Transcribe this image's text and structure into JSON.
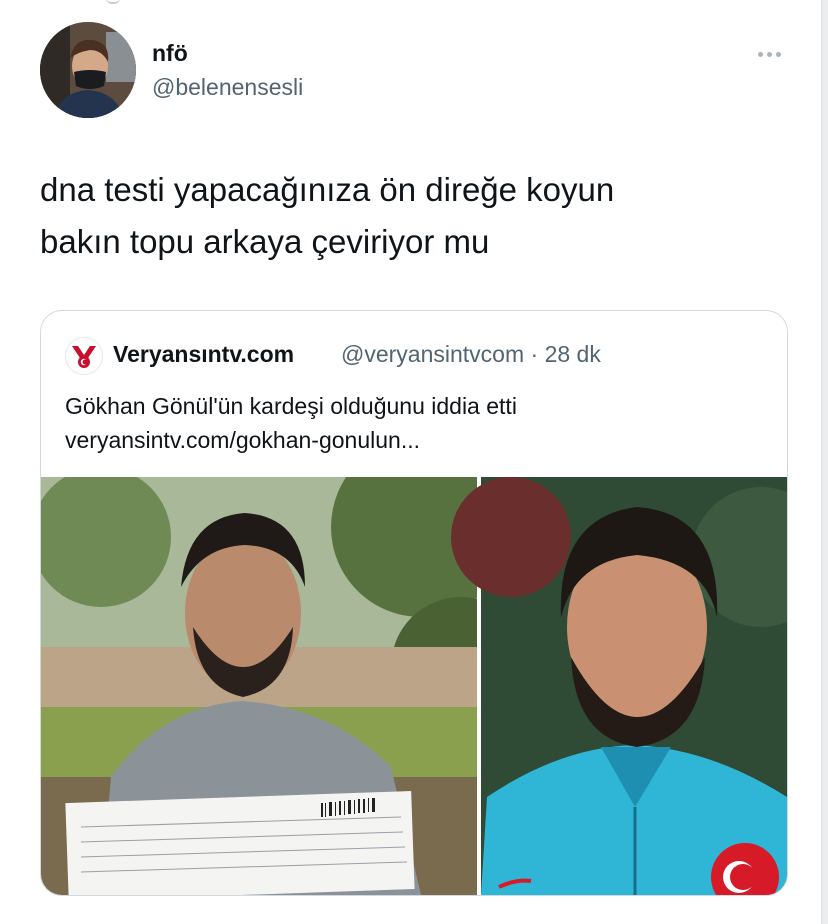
{
  "tweet": {
    "author": {
      "display_name": "nfö",
      "handle": "@belenensesli"
    },
    "text_line1": "dna testi yapacağınıza ön direğe koyun",
    "text_line2": "bakın topu arkaya çeviriyor mu",
    "more_icon": "more-horizontal-icon"
  },
  "quoted": {
    "display_name": "Veryansıntv.com",
    "handle": "@veryansintvcom",
    "separator": "·",
    "time": "28 dk",
    "text": "Gökhan Gönül'ün kardeşi olduğunu iddia etti",
    "link": "veryansintv.com/gokhan-gonulun...",
    "logo_icon": "veryansin-logo-icon",
    "accent_color": "#c8102e"
  },
  "colors": {
    "text_primary": "#0f1419",
    "text_secondary": "#536471",
    "border": "#cfd9de"
  }
}
